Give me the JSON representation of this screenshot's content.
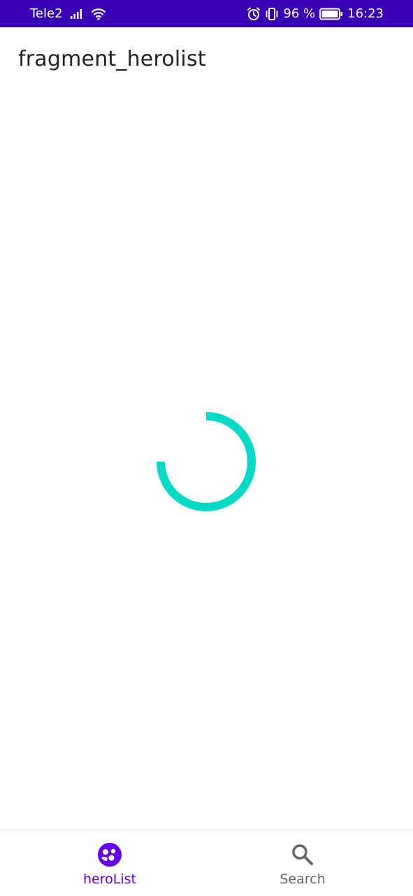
{
  "status_bar": {
    "carrier": "Tele2",
    "battery_percent": "96 %",
    "time": "16:23",
    "icons": [
      "signal-icon",
      "wifi-icon",
      "alarm-icon",
      "vibrate-icon",
      "battery-icon"
    ]
  },
  "toolbar": {
    "title": "fragment_herolist"
  },
  "content": {
    "loading_indicator": "progress-spinner-icon"
  },
  "bottom_nav": {
    "items": [
      {
        "label": "heroList",
        "icon": "hero-group-icon",
        "active": true
      },
      {
        "label": "Search",
        "icon": "search-icon",
        "active": false
      }
    ]
  },
  "colors": {
    "status_bar": "#3700b3",
    "accent": "#6200ee",
    "spinner": "#03dac5",
    "inactive": "#666666"
  }
}
